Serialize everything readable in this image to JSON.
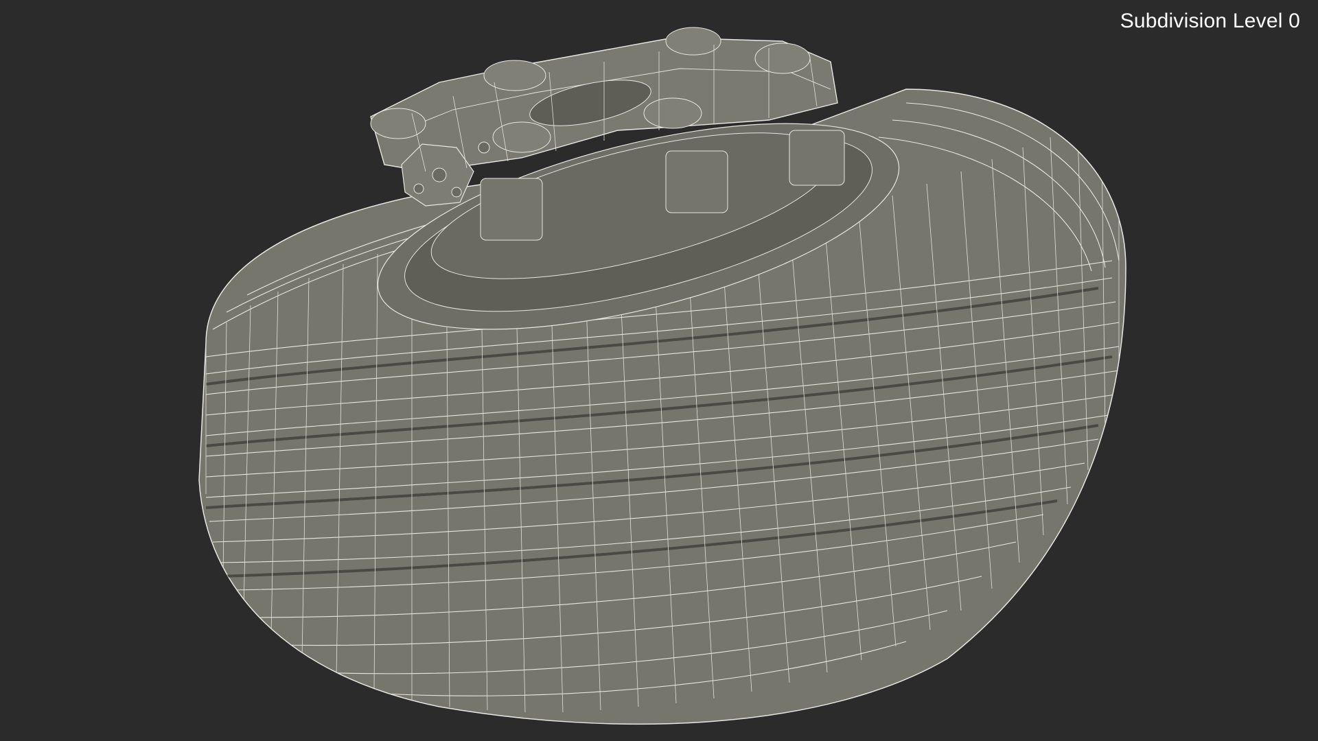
{
  "viewport": {
    "overlay_label": "Subdivision Level 0",
    "background_color": "#2b2b2b",
    "mesh_color": "#76766d",
    "wire_color": "#e8e8e2"
  },
  "model": {
    "icon": "wireframe-tire-mesh"
  }
}
